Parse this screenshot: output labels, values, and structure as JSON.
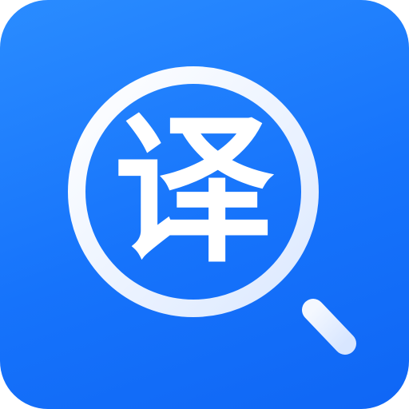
{
  "app_icon": {
    "glyph": "译",
    "icon_name": "magnifier-translate-icon",
    "colors": {
      "background": "#1673FB",
      "lens_ring": "#FFFFFF",
      "handle": "#EAF2FF",
      "glyph": "#FFFFFF"
    }
  }
}
